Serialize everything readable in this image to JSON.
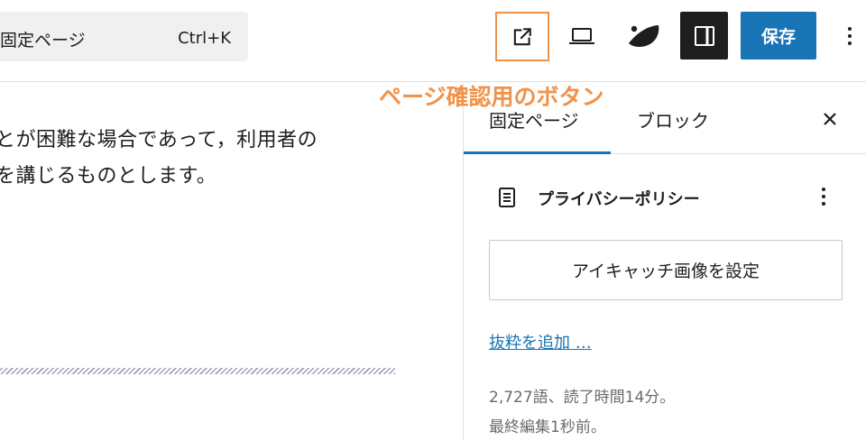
{
  "toolbar": {
    "command_title": "固定ページ",
    "command_shortcut": "Ctrl+K",
    "save_label": "保存"
  },
  "icons": {
    "view_page": "external-link-icon",
    "preview": "laptop-icon",
    "jetpack": "jetpack-leaf-icon",
    "settings": "sidebar-panel-icon",
    "more": "vertical-ellipsis-icon",
    "close": "close-icon",
    "document": "document-icon",
    "document_menu": "vertical-ellipsis-icon"
  },
  "colors": {
    "accent": "#1874b4",
    "annotation": "#f0924a",
    "dark_button": "#1e1e1e"
  },
  "annotation": {
    "text": "ページ確認用のボタン"
  },
  "editor": {
    "line1": "とが困難な場合であって，利用者の",
    "line2": "を講じるものとします。"
  },
  "sidebar": {
    "tabs": [
      {
        "label": "固定ページ",
        "active": true
      },
      {
        "label": "ブロック",
        "active": false
      }
    ],
    "document_title": "プライバシーポリシー",
    "featured_image_label": "アイキャッチ画像を設定",
    "excerpt_link": "抜粋を追加 …",
    "stats": "2,727語、読了時間14分。",
    "last_modified": "最終編集1秒前。"
  }
}
